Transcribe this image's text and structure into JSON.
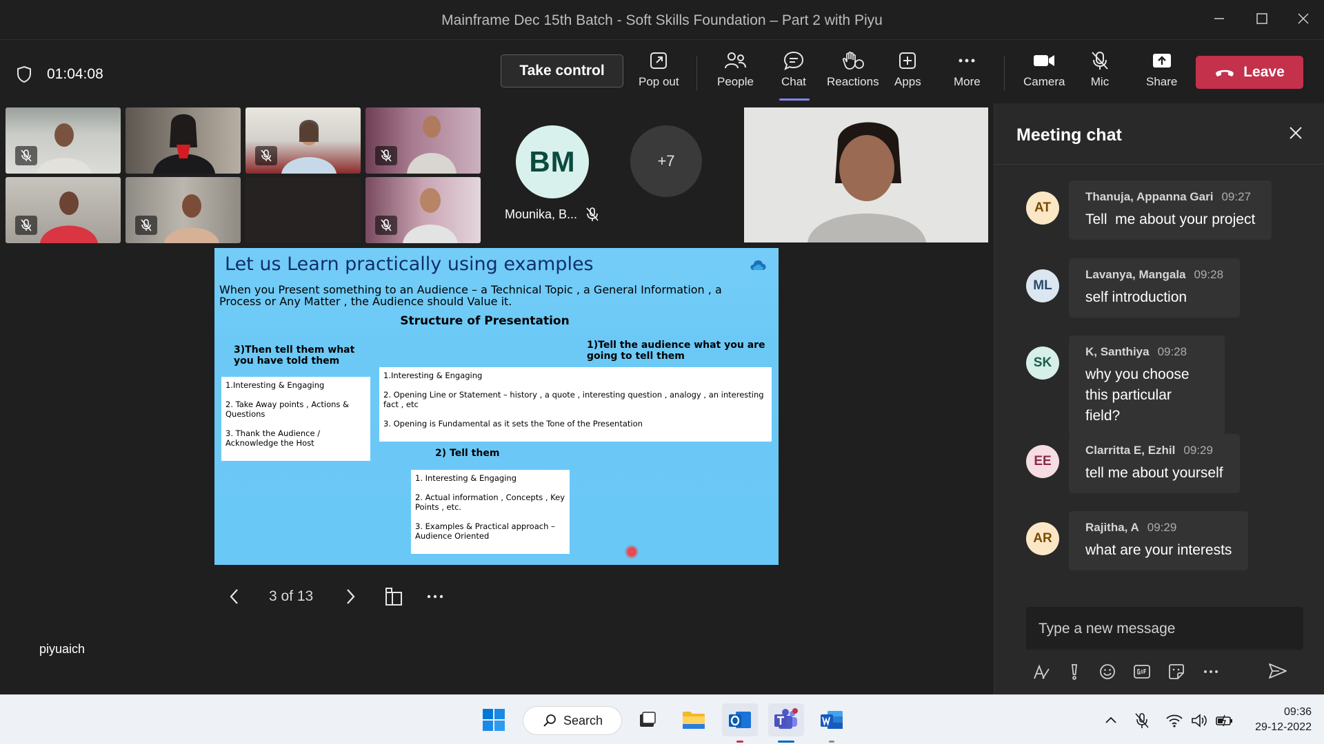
{
  "window": {
    "title": "Mainframe Dec 15th Batch - Soft Skills Foundation – Part 2 with Piyu"
  },
  "toolbar": {
    "timer": "01:04:08",
    "take_control": "Take control",
    "pop_out": "Pop out",
    "people": "People",
    "chat": "Chat",
    "reactions": "Reactions",
    "apps": "Apps",
    "more": "More",
    "camera": "Camera",
    "mic": "Mic",
    "share": "Share",
    "leave": "Leave"
  },
  "participants": {
    "bm_initials": "BM",
    "bm_name": "Mounika, B...",
    "overflow_count": "+7"
  },
  "slide": {
    "title": "Let us Learn practically using  examples",
    "intro": "When you Present something to an Audience – a Technical Topic , a General Information , a Process or Any Matter , the Audience should Value it.",
    "structure_heading": "Structure of Presentation",
    "section3_heading": "3)Then tell them what you have told them",
    "section3_items": [
      "1.Interesting & Engaging",
      "2. Take Away points , Actions & Questions",
      "3. Thank the Audience / Acknowledge the Host"
    ],
    "section1_heading": "1)Tell the audience what you are going to tell them",
    "section1_items": [
      "1.Interesting & Engaging",
      "2. Opening Line or Statement – history , a quote , interesting question , analogy , an interesting fact , etc",
      "3. Opening is Fundamental as it sets the Tone of the Presentation"
    ],
    "section2_heading": "2) Tell them",
    "section2_items": [
      "1.   Interesting & Engaging",
      "2. Actual information , Concepts , Key Points , etc.",
      "3. Examples & Practical approach – Audience Oriented"
    ]
  },
  "slide_nav": {
    "counter": "3 of 13"
  },
  "presenter": {
    "name": "piyuaich"
  },
  "chat": {
    "heading": "Meeting chat",
    "messages": [
      {
        "initials": "AT",
        "author": "Thanuja, Appanna Gari",
        "time": "09:27",
        "text": "Tell  me about your project",
        "avatar_bg": "#fbe7c6",
        "avatar_fg": "#7a4a00"
      },
      {
        "initials": "ML",
        "author": "Lavanya, Mangala",
        "time": "09:28",
        "text": "self introduction",
        "avatar_bg": "#dbe6f1",
        "avatar_fg": "#2c4a6b"
      },
      {
        "initials": "SK",
        "author": "K, Santhiya",
        "time": "09:28",
        "text": "why you choose this particular field?",
        "avatar_bg": "#d6efe8",
        "avatar_fg": "#1b5e4b"
      },
      {
        "initials": "EE",
        "author": "Clarritta E, Ezhil",
        "time": "09:29",
        "text": "tell me about yourself",
        "avatar_bg": "#f6dce3",
        "avatar_fg": "#8a2a45"
      },
      {
        "initials": "AR",
        "author": "Rajitha, A",
        "time": "09:29",
        "text": "what are your interests",
        "avatar_bg": "#fbe7c6",
        "avatar_fg": "#7a4a00"
      }
    ],
    "compose_placeholder": "Type a new message"
  },
  "taskbar": {
    "search": "Search",
    "time": "09:36",
    "date": "29-12-2022"
  },
  "colors": {
    "leave": "#c4314b",
    "accent": "#7f85f5",
    "slide_bg": "#6ac8f7"
  }
}
